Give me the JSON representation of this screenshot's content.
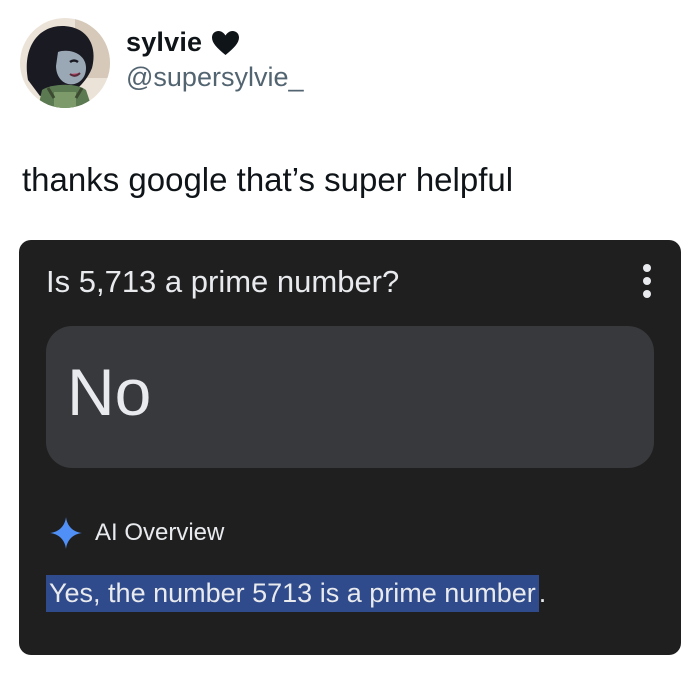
{
  "tweet": {
    "display_name": "sylvie",
    "handle": "@supersylvie_",
    "text": "thanks google that’s super helpful",
    "name_emoji_icon": "black-heart-icon",
    "avatar_icon": "cartoon-avatar-icon"
  },
  "screenshot": {
    "question": "Is 5,713 a prime number?",
    "answer": "No",
    "more_icon": "more-vertical-icon",
    "ai_overview": {
      "icon": "gemini-sparkle-icon",
      "label": "AI Overview",
      "highlighted_text": "Yes, the number 5713 is a prime number",
      "trailing_text": "."
    }
  },
  "colors": {
    "page_background": "#ffffff",
    "card_background": "#1f1f1f",
    "answer_box_background": "#38393c",
    "highlight": "#304b8c",
    "sparkle_blue": "#4f8ff6",
    "handle_gray": "#536471"
  }
}
